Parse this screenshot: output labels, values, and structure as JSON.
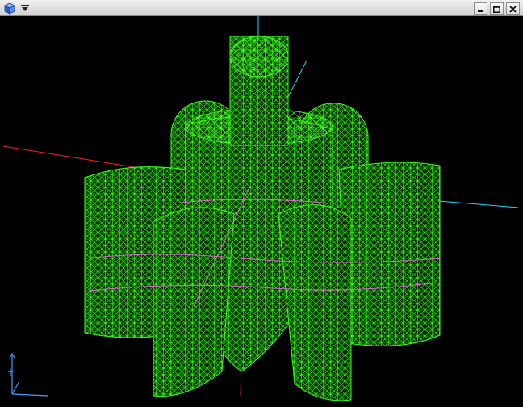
{
  "window": {
    "title": "",
    "controls": [
      "minimize-icon",
      "maximize-icon",
      "close-icon"
    ]
  },
  "viewport": {
    "background": "#000000",
    "mesh_color": "#3cff18",
    "edge_color": "#ff66ff",
    "axis_colors": {
      "x": "#ff2020",
      "y": "#20ddff",
      "z": "#ff2020"
    },
    "orientation_triad_color": "#40a0ff"
  }
}
